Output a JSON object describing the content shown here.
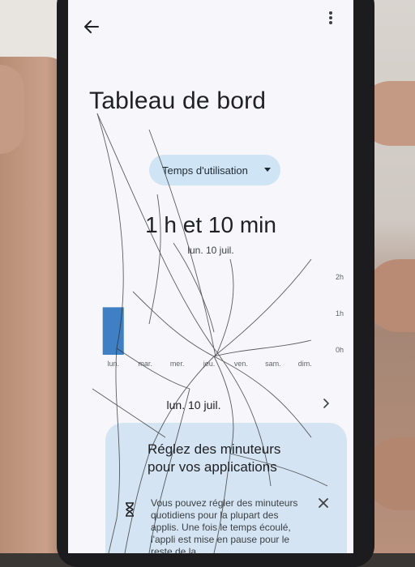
{
  "header": {
    "title": "Tableau de bord"
  },
  "metric_selector": {
    "selected": "Temps d'utilisation"
  },
  "usage": {
    "total": "1 h et 10 min",
    "date": "lun. 10 juil."
  },
  "chart_data": {
    "type": "bar",
    "categories": [
      "lun.",
      "mar.",
      "mer.",
      "jeu.",
      "ven.",
      "sam.",
      "dim."
    ],
    "values": [
      1.17,
      0,
      0,
      0,
      0,
      0,
      0
    ],
    "y_ticks": [
      "2h",
      "1h",
      "0h"
    ],
    "ylim": [
      0,
      2
    ],
    "bar_color": "#3f7fc4",
    "selected_category": "lun."
  },
  "day_selector": {
    "label": "lun. 10 juil."
  },
  "timer_card": {
    "title": "Réglez des minuteurs pour vos applications",
    "body": "Vous pouvez régler des minuteurs quotidiens pour la plupart des applis. Une fois le temps écoulé, l'appli est mise en pause pour le reste de la"
  },
  "colors": {
    "accent": "#3f7fc4",
    "dropdown_bg": "#cfe4f5",
    "card_bg": "#d4e4f2",
    "screen_bg": "#f7f6fa"
  }
}
